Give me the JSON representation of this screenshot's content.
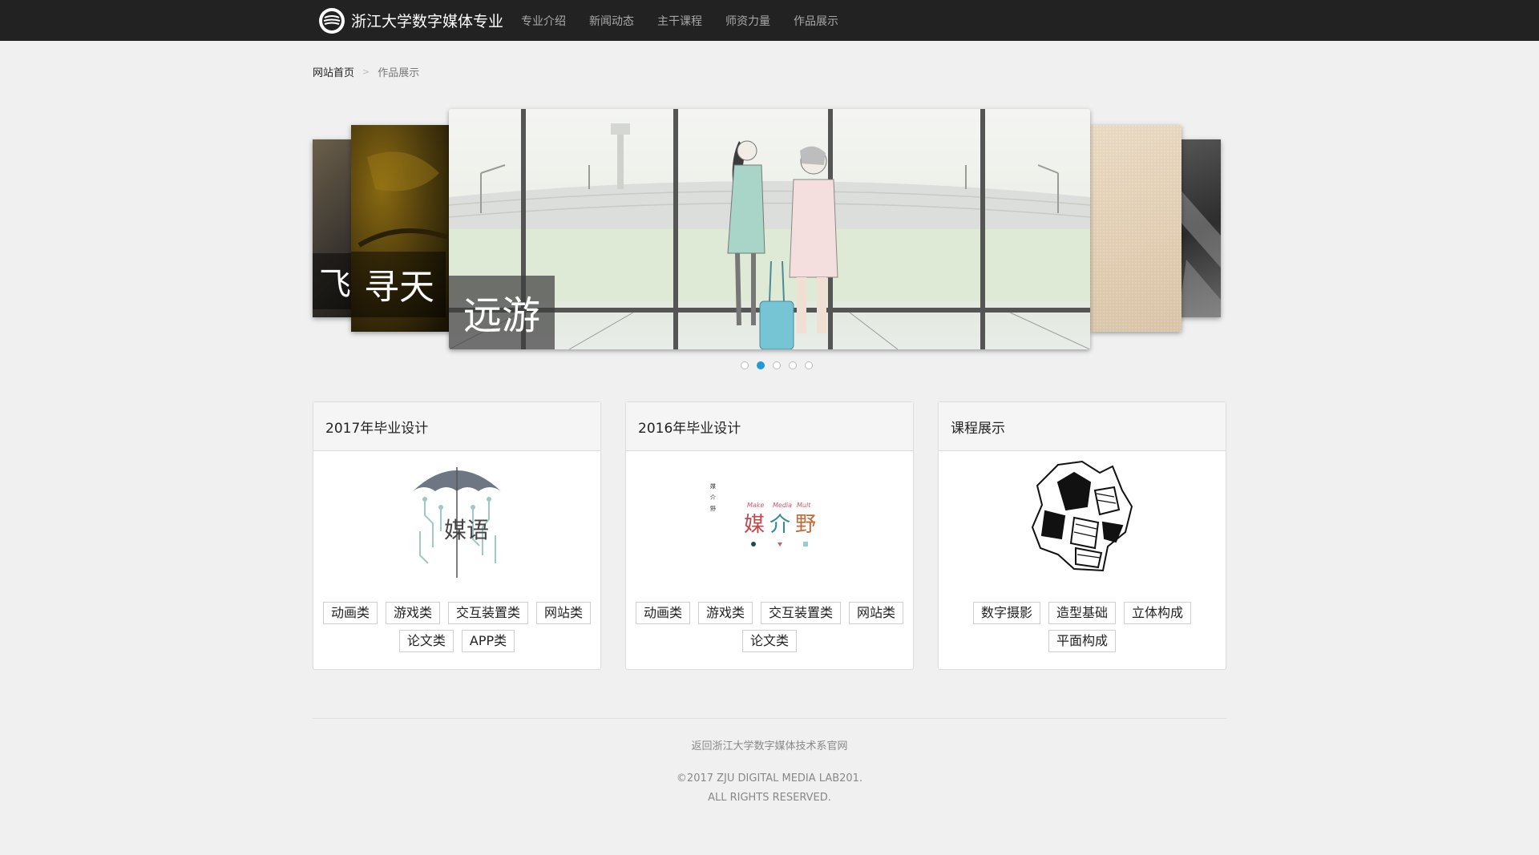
{
  "nav": {
    "brand": "浙江大学数字媒体专业",
    "links": [
      "专业介绍",
      "新闻动态",
      "主干课程",
      "师资力量",
      "作品展示"
    ]
  },
  "breadcrumb": {
    "home": "网站首页",
    "current": "作品展示"
  },
  "carousel": {
    "captions": {
      "far_left": "飞",
      "left": "寻天",
      "main": "远游"
    },
    "active_index": 1,
    "dot_count": 5,
    "accent_color": "#1e9ad6"
  },
  "panels": [
    {
      "title": "2017年毕业设计",
      "image_icon": "umbrella-logo-icon",
      "logo_text": "媒语",
      "tags": [
        "动画类",
        "游戏类",
        "交互装置类",
        "网站类",
        "论文类",
        "APP类"
      ]
    },
    {
      "title": "2016年毕业设计",
      "image_icon": "media-wild-logo-icon",
      "logo_text": "媒介野",
      "logo_small": "媒介野",
      "logo_words": [
        "Make",
        "Media",
        "Mult"
      ],
      "tags": [
        "动画类",
        "游戏类",
        "交互装置类",
        "网站类",
        "论文类"
      ]
    },
    {
      "title": "课程展示",
      "image_icon": "sketch-city-icon",
      "tags": [
        "数字摄影",
        "造型基础",
        "立体构成",
        "平面构成"
      ]
    }
  ],
  "footer": {
    "link": "返回浙江大学数字媒体技术系官网",
    "copyright": "©2017 ZJU DIGITAL MEDIA LAB201.",
    "rights": "ALL RIGHTS RESERVED."
  }
}
